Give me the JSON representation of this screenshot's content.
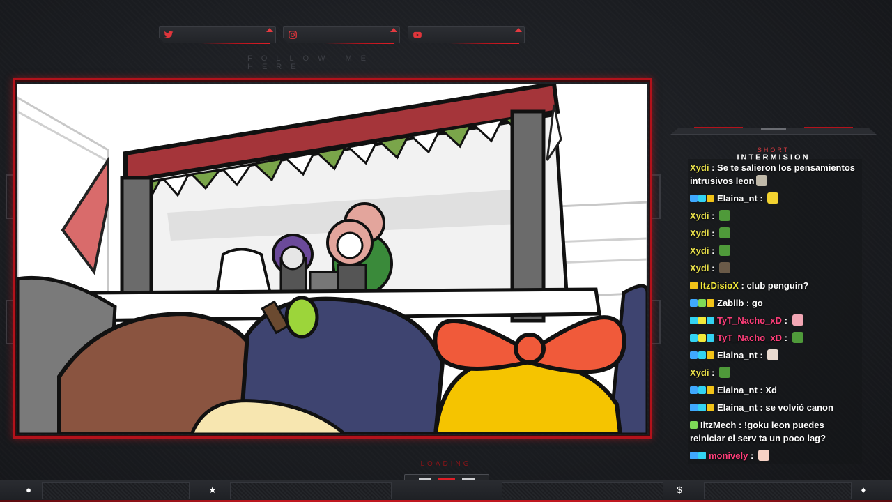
{
  "social": {
    "items": [
      {
        "name": "twitter",
        "icon": "twitter-icon"
      },
      {
        "name": "instagram",
        "icon": "instagram-icon"
      },
      {
        "name": "youtube",
        "icon": "youtube-icon"
      }
    ],
    "follow_text": "FOLLOW ME HERE"
  },
  "chat": {
    "title_small": "SHORT",
    "title_main": "INTERMISION",
    "messages": [
      {
        "user": "Xydi",
        "color": "#e9e04a",
        "badges": [],
        "text": "Se te salieron los pensamientos intrusivos leon",
        "emote": "frog-emote"
      },
      {
        "user": "Elaina_nt",
        "color": "#ffffff",
        "badges": [
          "#3fa9ff",
          "#33d3f2",
          "#f2c318"
        ],
        "text": "",
        "emote": "pikachu-emote"
      },
      {
        "user": "Xydi",
        "color": "#e9e04a",
        "badges": [],
        "text": "",
        "emote": "pepe-emote"
      },
      {
        "user": "Xydi",
        "color": "#e9e04a",
        "badges": [],
        "text": "",
        "emote": "pepe-emote"
      },
      {
        "user": "Xydi",
        "color": "#e9e04a",
        "badges": [],
        "text": "",
        "emote": "pepe-emote"
      },
      {
        "user": "Xydi",
        "color": "#e9e04a",
        "badges": [],
        "text": "",
        "emote": "dog-emote"
      },
      {
        "user": "ItzDisioX",
        "color": "#f2e83a",
        "badges": [
          "#f2c318"
        ],
        "text": "club penguin?",
        "emote": ""
      },
      {
        "user": "Zabilb",
        "color": "#ffffff",
        "badges": [
          "#3fa9ff",
          "#7ed957",
          "#f2c318"
        ],
        "text": "go",
        "emote": ""
      },
      {
        "user": "TyT_Nacho_xD",
        "color": "#ff3e7a",
        "badges": [
          "#33d3f2",
          "#f2e83a",
          "#33d3f2"
        ],
        "text": "",
        "emote": "pig-emote"
      },
      {
        "user": "TyT_Nacho_xD",
        "color": "#ff3e7a",
        "badges": [
          "#33d3f2",
          "#f2e83a",
          "#33d3f2"
        ],
        "text": "",
        "emote": "pepe-emote"
      },
      {
        "user": "Elaina_nt",
        "color": "#ffffff",
        "badges": [
          "#3fa9ff",
          "#33d3f2",
          "#f2c318"
        ],
        "text": "",
        "emote": "cat-emote"
      },
      {
        "user": "Xydi",
        "color": "#e9e04a",
        "badges": [],
        "text": "",
        "emote": "pepe-emote"
      },
      {
        "user": "Elaina_nt",
        "color": "#ffffff",
        "badges": [
          "#3fa9ff",
          "#33d3f2",
          "#f2c318"
        ],
        "text": "Xd",
        "emote": ""
      },
      {
        "user": "Elaina_nt",
        "color": "#ffffff",
        "badges": [
          "#3fa9ff",
          "#33d3f2",
          "#f2c318"
        ],
        "text": "se volvió canon",
        "emote": ""
      },
      {
        "user": "IitzMech",
        "color": "#ffffff",
        "badges": [
          "#7ed957"
        ],
        "text": "!goku leon puedes reiniciar el serv ta un poco lag?",
        "emote": ""
      },
      {
        "user": "monively",
        "color": "#ff3e7a",
        "badges": [
          "#3fa9ff",
          "#33d3f2"
        ],
        "text": "",
        "emote": "hand-emote"
      }
    ]
  },
  "bottom": {
    "loading": "LOADING",
    "buttons": [
      {
        "name": "user-icon",
        "glyph": "●"
      },
      {
        "name": "star-icon",
        "glyph": "★"
      },
      {
        "name": "dollar-icon",
        "glyph": "$"
      },
      {
        "name": "drop-icon",
        "glyph": "♦"
      }
    ]
  },
  "colors": {
    "accent": "#b3121b",
    "bg": "#1b1d21"
  }
}
